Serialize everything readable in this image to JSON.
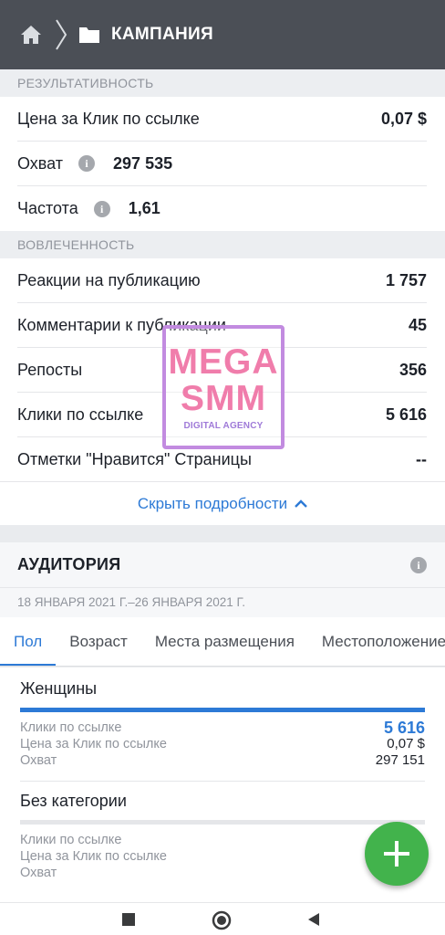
{
  "header": {
    "title": "КАМПАНИЯ"
  },
  "performance": {
    "section_label": "РЕЗУЛЬТАТИВНОСТЬ",
    "rows": [
      {
        "label": "Цена за Клик по ссылке",
        "value": "0,07 $"
      },
      {
        "label": "Охват",
        "value": "297 535"
      },
      {
        "label": "Частота",
        "value": "1,61"
      }
    ]
  },
  "engagement": {
    "section_label": "ВОВЛЕЧЕННОСТЬ",
    "rows": [
      {
        "label": "Реакции на публикацию",
        "value": "1 757"
      },
      {
        "label": "Комментарии к публикации",
        "value": "45"
      },
      {
        "label": "Репосты",
        "value": "356"
      },
      {
        "label": "Клики по ссылке",
        "value": "5 616"
      },
      {
        "label": "Отметки \"Нравится\" Страницы",
        "value": "--"
      }
    ]
  },
  "toggle": {
    "label": "Скрыть подробности"
  },
  "audience": {
    "title": "АУДИТОРИЯ",
    "date_range": "18 ЯНВАРЯ 2021 Г.–26 ЯНВАРЯ 2021 Г.",
    "tabs": [
      "Пол",
      "Возраст",
      "Места размещения",
      "Местоположение"
    ],
    "active_tab": 0,
    "cards": [
      {
        "title": "Женщины",
        "bar_fraction": 1.0,
        "metrics": [
          {
            "label": "Клики по ссылке",
            "value": "5 616"
          },
          {
            "label": "Цена за Клик по ссылке",
            "value": "0,07 $"
          },
          {
            "label": "Охват",
            "value": "297 151"
          }
        ]
      },
      {
        "title": "Без категории",
        "bar_fraction": 0.0,
        "metrics": [
          {
            "label": "Клики по ссылке",
            "value": ""
          },
          {
            "label": "Цена за Клик по ссылке",
            "value": ""
          },
          {
            "label": "Охват",
            "value": ""
          }
        ]
      }
    ]
  },
  "watermark": {
    "line1": "MEGA",
    "line2": "SMM",
    "line3": "DIGITAL AGENCY"
  },
  "icons": {
    "fab": "plus-icon",
    "accent": "#2d7ad6",
    "fab_color": "#42b34c"
  }
}
